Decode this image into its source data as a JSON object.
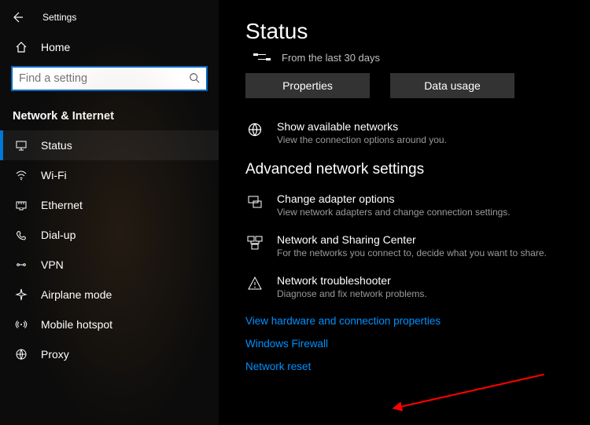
{
  "titlebar": {
    "app_name": "Settings"
  },
  "home_label": "Home",
  "search": {
    "placeholder": "Find a setting"
  },
  "section_header": "Network & Internet",
  "nav": [
    {
      "label": "Status"
    },
    {
      "label": "Wi-Fi"
    },
    {
      "label": "Ethernet"
    },
    {
      "label": "Dial-up"
    },
    {
      "label": "VPN"
    },
    {
      "label": "Airplane mode"
    },
    {
      "label": "Mobile hotspot"
    },
    {
      "label": "Proxy"
    }
  ],
  "main": {
    "title": "Status",
    "timeline_text": "From the last 30 days",
    "btn_properties": "Properties",
    "btn_data_usage": "Data usage",
    "show_networks": {
      "title": "Show available networks",
      "sub": "View the connection options around you."
    },
    "adv_heading": "Advanced network settings",
    "adapter": {
      "title": "Change adapter options",
      "sub": "View network adapters and change connection settings."
    },
    "sharing": {
      "title": "Network and Sharing Center",
      "sub": "For the networks you connect to, decide what you want to share."
    },
    "troubleshoot": {
      "title": "Network troubleshooter",
      "sub": "Diagnose and fix network problems."
    },
    "link_hw": "View hardware and connection properties",
    "link_firewall": "Windows Firewall",
    "link_reset": "Network reset"
  }
}
